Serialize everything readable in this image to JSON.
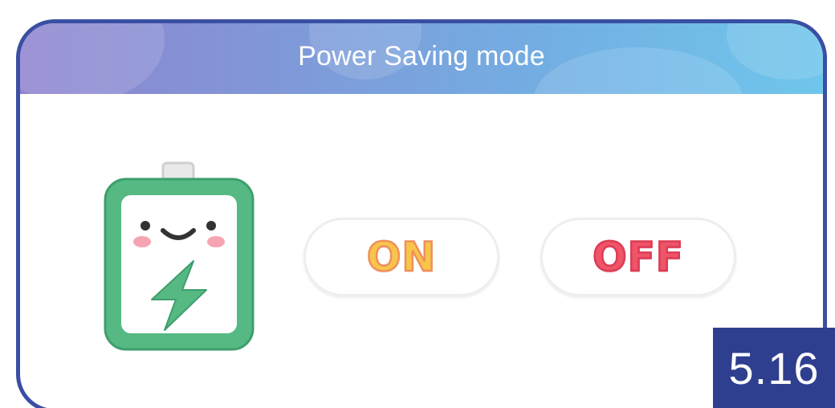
{
  "dialog": {
    "title": "Power Saving mode"
  },
  "battery_icon": {
    "icon": "smiling-battery-charging-icon",
    "colors": {
      "frame": "#56b983",
      "frame_stroke": "#3e9e6c",
      "bolt": "#56b983",
      "terminal": "#e9e9e9",
      "blush": "#f6a3b3",
      "face": "#333333"
    }
  },
  "options": {
    "on_label": "ON",
    "off_label": "OFF"
  },
  "colors": {
    "header_gradient": [
      "#8f84cf",
      "#73aee3",
      "#6fc6ec"
    ],
    "border": "#3a4fa3",
    "on_fill": "#f8c54a",
    "on_stroke": "#f08f5c",
    "off_fill": "#ef5468",
    "off_stroke": "#dc3c55",
    "badge_bg": "#2f3f8f"
  },
  "badge": {
    "text": "5.16"
  }
}
